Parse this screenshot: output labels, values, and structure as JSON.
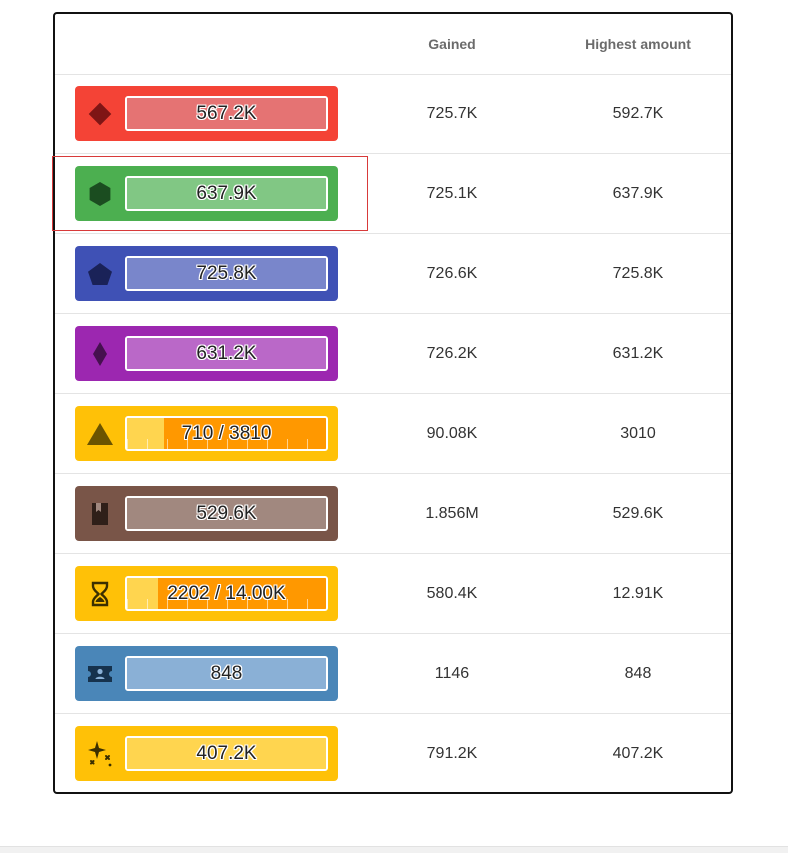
{
  "columns": {
    "gained": "Gained",
    "highest": "Highest amount"
  },
  "rows": [
    {
      "name": "diamond",
      "icon": "diamond-icon",
      "bar_text": "567.2K",
      "gained": "725.7K",
      "highest": "592.7K",
      "colors": {
        "badge": "#f44336",
        "bar": "#e57373",
        "icon": "#7f1515"
      }
    },
    {
      "name": "hexagon",
      "icon": "hexagon-icon",
      "bar_text": "637.9K",
      "gained": "725.1K",
      "highest": "637.9K",
      "colors": {
        "badge": "#4caf50",
        "bar": "#81c784",
        "icon": "#1b4d20"
      }
    },
    {
      "name": "pentagon",
      "icon": "pentagon-icon",
      "bar_text": "725.8K",
      "gained": "726.6K",
      "highest": "725.8K",
      "colors": {
        "badge": "#3f51b5",
        "bar": "#7986cb",
        "icon": "#1a2258"
      }
    },
    {
      "name": "gem",
      "icon": "gem-icon",
      "bar_text": "631.2K",
      "gained": "726.2K",
      "highest": "631.2K",
      "colors": {
        "badge": "#9c27b0",
        "bar": "#ba68c8",
        "icon": "#46104f"
      }
    },
    {
      "name": "triangle",
      "icon": "triangle-icon",
      "bar_text": "710 / 3810",
      "progress": 0.186,
      "gained": "90.08K",
      "highest": "3010",
      "colors": {
        "badge": "#ffc107",
        "bar": "#ffd54f",
        "rest": "#ff9800",
        "icon": "#6b5400"
      }
    },
    {
      "name": "book",
      "icon": "book-icon",
      "bar_text": "529.6K",
      "gained": "1.856M",
      "highest": "529.6K",
      "colors": {
        "badge": "#795548",
        "bar": "#a1887f",
        "icon": "#2f1f19"
      }
    },
    {
      "name": "hourglass",
      "icon": "hourglass-icon",
      "bar_text": "2202 / 14.00K",
      "progress": 0.157,
      "gained": "580.4K",
      "highest": "12.91K",
      "colors": {
        "badge": "#ffc107",
        "bar": "#ffd54f",
        "rest": "#ff9800",
        "icon": "#3b2f00"
      }
    },
    {
      "name": "ticket",
      "icon": "ticket-icon",
      "bar_text": "848",
      "gained": "1146",
      "highest": "848",
      "colors": {
        "badge": "#4a86b8",
        "bar": "#8ab0d6",
        "icon": "#16324d"
      }
    },
    {
      "name": "sparkles",
      "icon": "sparkles-icon",
      "bar_text": "407.2K",
      "gained": "791.2K",
      "highest": "407.2K",
      "colors": {
        "badge": "#ffc107",
        "bar": "#ffd54f",
        "icon": "#3b2f00"
      }
    }
  ]
}
